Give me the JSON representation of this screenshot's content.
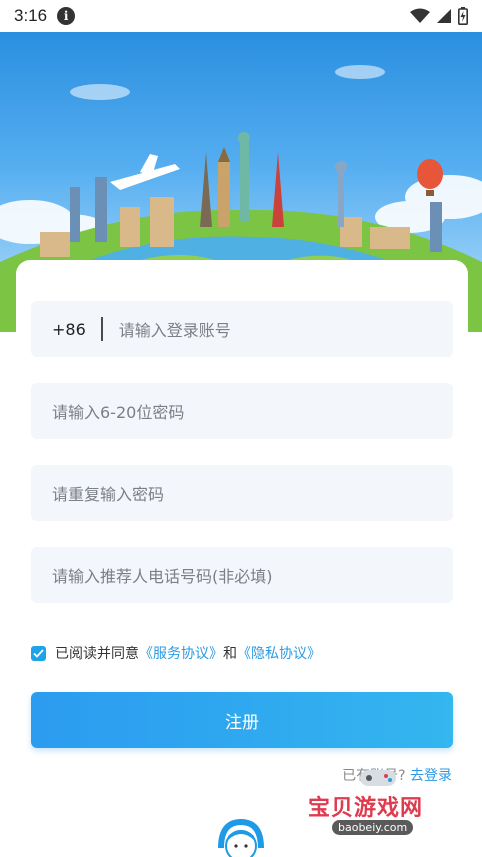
{
  "status_bar": {
    "time": "3:16",
    "icons": [
      "info-icon",
      "wifi-icon",
      "signal-icon",
      "battery-icon"
    ]
  },
  "form": {
    "country_code": "+86",
    "account_placeholder": "请输入登录账号",
    "password_placeholder": "请输入6-20位密码",
    "confirm_placeholder": "请重复输入密码",
    "referrer_placeholder": "请输入推荐人电话号码(非必填)"
  },
  "agreement": {
    "checked": true,
    "prefix": "已阅读并同意",
    "service_link": "《服务协议》",
    "and": "和",
    "privacy_link": "《隐私协议》"
  },
  "register_button": "注册",
  "login_prompt": {
    "text": "已有账号?",
    "link": "去登录"
  },
  "watermark": {
    "title": "宝贝游戏网",
    "url": "baobeiy.com"
  },
  "colors": {
    "accent": "#2b9be3",
    "button_start": "#2c9cf0",
    "button_end": "#34b6ef",
    "field_bg": "#f3f6fa",
    "sky": "#56aef0"
  }
}
